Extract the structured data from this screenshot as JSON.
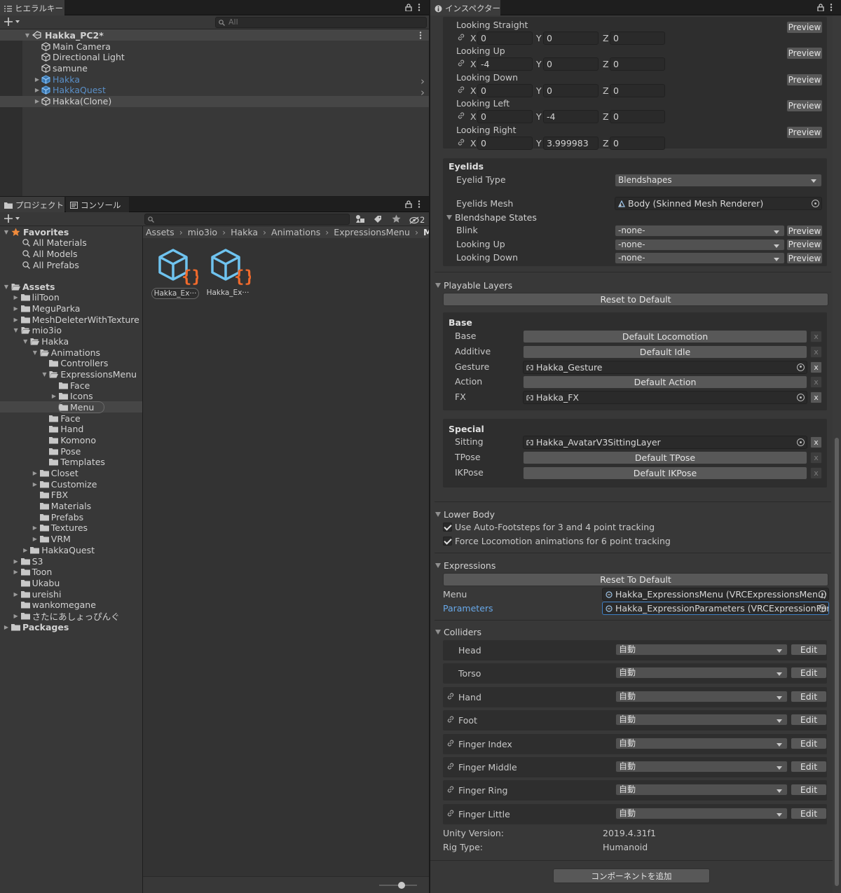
{
  "colors": {
    "accent_blue": "#68a9ea",
    "orange": "#f08b3c",
    "bg": "#383838"
  },
  "hierarchy": {
    "tab_label": "ヒエラルキー",
    "search_placeholder": "All",
    "scene": "Hakka_PC2*",
    "items": [
      {
        "label": "Main Camera",
        "kind": "object"
      },
      {
        "label": "Directional Light",
        "kind": "object"
      },
      {
        "label": "samune",
        "kind": "object"
      },
      {
        "label": "Hakka",
        "kind": "prefab"
      },
      {
        "label": "HakkaQuest",
        "kind": "prefab"
      },
      {
        "label": "Hakka(Clone)",
        "kind": "object"
      }
    ]
  },
  "project": {
    "tab_project": "プロジェクト",
    "tab_console": "コンソール",
    "hidden_count": "2",
    "breadcrumb": [
      "Assets",
      "mio3io",
      "Hakka",
      "Animations",
      "ExpressionsMenu",
      "Menu"
    ],
    "favorites_label": "Favorites",
    "favorites": [
      "All Materials",
      "All Models",
      "All Prefabs"
    ],
    "tree": [
      {
        "label": "Assets",
        "depth": 0,
        "arrow": "open",
        "bold": true
      },
      {
        "label": "lilToon",
        "depth": 1,
        "arrow": "closed"
      },
      {
        "label": "MeguParka",
        "depth": 1,
        "arrow": "closed"
      },
      {
        "label": "MeshDeleterWithTexture",
        "depth": 1,
        "arrow": "closed"
      },
      {
        "label": "mio3io",
        "depth": 1,
        "arrow": "open"
      },
      {
        "label": "Hakka",
        "depth": 2,
        "arrow": "open"
      },
      {
        "label": "Animations",
        "depth": 3,
        "arrow": "open"
      },
      {
        "label": "Controllers",
        "depth": 4,
        "arrow": "none"
      },
      {
        "label": "ExpressionsMenu",
        "depth": 4,
        "arrow": "open"
      },
      {
        "label": "Face",
        "depth": 5,
        "arrow": "none"
      },
      {
        "label": "Icons",
        "depth": 5,
        "arrow": "closed"
      },
      {
        "label": "Menu",
        "depth": 5,
        "arrow": "none",
        "selected": true
      },
      {
        "label": "Face",
        "depth": 4,
        "arrow": "none"
      },
      {
        "label": "Hand",
        "depth": 4,
        "arrow": "none"
      },
      {
        "label": "Komono",
        "depth": 4,
        "arrow": "none"
      },
      {
        "label": "Pose",
        "depth": 4,
        "arrow": "none"
      },
      {
        "label": "Templates",
        "depth": 4,
        "arrow": "none"
      },
      {
        "label": "Closet",
        "depth": 3,
        "arrow": "closed"
      },
      {
        "label": "Customize",
        "depth": 3,
        "arrow": "closed"
      },
      {
        "label": "FBX",
        "depth": 3,
        "arrow": "none"
      },
      {
        "label": "Materials",
        "depth": 3,
        "arrow": "none"
      },
      {
        "label": "Prefabs",
        "depth": 3,
        "arrow": "none"
      },
      {
        "label": "Textures",
        "depth": 3,
        "arrow": "closed"
      },
      {
        "label": "VRM",
        "depth": 3,
        "arrow": "closed"
      },
      {
        "label": "HakkaQuest",
        "depth": 2,
        "arrow": "closed"
      },
      {
        "label": "S3",
        "depth": 1,
        "arrow": "closed"
      },
      {
        "label": "Toon",
        "depth": 1,
        "arrow": "closed"
      },
      {
        "label": "Ukabu",
        "depth": 1,
        "arrow": "none"
      },
      {
        "label": "ureishi",
        "depth": 1,
        "arrow": "closed"
      },
      {
        "label": "wankomegane",
        "depth": 1,
        "arrow": "none"
      },
      {
        "label": "さたにあしょっぴんぐ",
        "depth": 1,
        "arrow": "closed"
      },
      {
        "label": "Packages",
        "depth": 0,
        "arrow": "closed",
        "bold": true
      }
    ],
    "assets": [
      {
        "label": "Hakka_Ex···",
        "selected": true
      },
      {
        "label": "Hakka_Ex···",
        "selected": false
      }
    ]
  },
  "inspector": {
    "tab_label": "インスペクター",
    "eye_rows": [
      {
        "label": "Looking Straight",
        "x": "0",
        "y": "0",
        "z": "0"
      },
      {
        "label": "Looking Up",
        "x": "-4",
        "y": "0",
        "z": "0"
      },
      {
        "label": "Looking Down",
        "x": "0",
        "y": "0",
        "z": "0"
      },
      {
        "label": "Looking Left",
        "x": "0",
        "y": "-4",
        "z": "0"
      },
      {
        "label": "Looking Right",
        "x": "0",
        "y": "3.999983",
        "z": "0"
      }
    ],
    "preview_label": "Preview",
    "axis": {
      "x": "X",
      "y": "Y",
      "z": "Z"
    },
    "eyelids": {
      "header": "Eyelids",
      "type_label": "Eyelid Type",
      "type_value": "Blendshapes",
      "mesh_label": "Eyelids Mesh",
      "mesh_value": "Body (Skinned Mesh Renderer)",
      "states_label": "Blendshape States",
      "states": [
        {
          "label": "Blink",
          "value": "-none-"
        },
        {
          "label": "Looking Up",
          "value": "-none-"
        },
        {
          "label": "Looking Down",
          "value": "-none-"
        }
      ]
    },
    "playable": {
      "header": "Playable Layers",
      "reset": "Reset to Default",
      "base_header": "Base",
      "base": [
        {
          "label": "Base",
          "value": "Default Locomotion",
          "kind": "button"
        },
        {
          "label": "Additive",
          "value": "Default Idle",
          "kind": "button"
        },
        {
          "label": "Gesture",
          "value": "Hakka_Gesture",
          "kind": "object"
        },
        {
          "label": "Action",
          "value": "Default Action",
          "kind": "button"
        },
        {
          "label": "FX",
          "value": "Hakka_FX",
          "kind": "object"
        }
      ],
      "special_header": "Special",
      "special": [
        {
          "label": "Sitting",
          "value": "Hakka_AvatarV3SittingLayer",
          "kind": "object"
        },
        {
          "label": "TPose",
          "value": "Default TPose",
          "kind": "button"
        },
        {
          "label": "IKPose",
          "value": "Default IKPose",
          "kind": "button"
        }
      ]
    },
    "lower_body": {
      "header": "Lower Body",
      "checks": [
        {
          "label": "Use Auto-Footsteps for 3 and 4 point tracking",
          "checked": true
        },
        {
          "label": "Force Locomotion animations for 6 point tracking",
          "checked": true
        }
      ]
    },
    "expressions": {
      "header": "Expressions",
      "reset": "Reset To Default",
      "menu_label": "Menu",
      "menu_value": "Hakka_ExpressionsMenu (VRCExpressionsMenu)",
      "params_label": "Parameters",
      "params_value": "Hakka_ExpressionParameters (VRCExpressionPara"
    },
    "colliders": {
      "header": "Colliders",
      "edit_label": "Edit",
      "rows": [
        {
          "label": "Head",
          "value": "自動",
          "linked": false
        },
        {
          "label": "Torso",
          "value": "自動",
          "linked": false
        },
        {
          "label": "Hand",
          "value": "自動",
          "linked": true
        },
        {
          "label": "Foot",
          "value": "自動",
          "linked": true
        },
        {
          "label": "Finger Index",
          "value": "自動",
          "linked": true
        },
        {
          "label": "Finger Middle",
          "value": "自動",
          "linked": true
        },
        {
          "label": "Finger Ring",
          "value": "自動",
          "linked": true
        },
        {
          "label": "Finger Little",
          "value": "自動",
          "linked": true
        }
      ]
    },
    "info": [
      {
        "label": "Unity Version:",
        "value": "2019.4.31f1"
      },
      {
        "label": "Rig Type:",
        "value": "Humanoid"
      }
    ],
    "add_component": "コンポーネントを追加"
  }
}
